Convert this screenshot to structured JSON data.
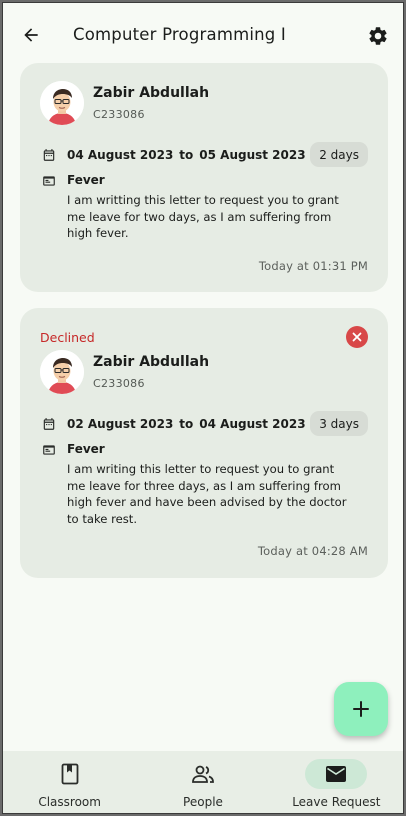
{
  "header": {
    "title": "Computer Programming I"
  },
  "requests": [
    {
      "status": "",
      "name": "Zabir Abdullah",
      "student_id": "C233086",
      "from_date": "04 August 2023",
      "to_word": "to",
      "to_date": "05 August 2023",
      "days": "2 days",
      "reason": "Fever",
      "body_lines": [
        "I am writting this letter to request you to grant",
        "me leave for two days, as I am suffering from",
        "high fever."
      ],
      "time": "Today at 01:31 PM"
    },
    {
      "status": "Declined",
      "name": "Zabir Abdullah",
      "student_id": "C233086",
      "from_date": "02 August 2023",
      "to_word": "to",
      "to_date": "04 August 2023",
      "days": "3 days",
      "reason": "Fever",
      "body_lines": [
        "I am writing this letter to request you to grant",
        "me leave for three days, as I am suffering from",
        "high fever and have been advised by the doctor",
        "to take rest."
      ],
      "time": "Today at 04:28 AM"
    }
  ],
  "bottom_nav": {
    "items": [
      {
        "label": "Classroom",
        "icon": "book-icon"
      },
      {
        "label": "People",
        "icon": "people-icon"
      },
      {
        "label": "Leave Request",
        "icon": "mail-icon"
      }
    ],
    "active": "Leave Request"
  },
  "colors": {
    "background": "#f7faf5",
    "card": "#e6ece4",
    "declined": "#c62828",
    "fab": "#8ef0bd",
    "nav_active": "#cde8d6"
  }
}
